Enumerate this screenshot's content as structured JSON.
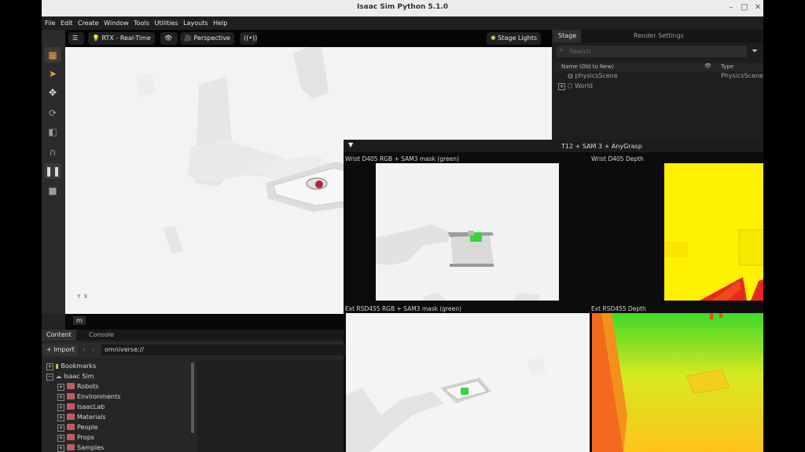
{
  "window": {
    "title": "Isaac Sim Python 5.1.0"
  },
  "menu": [
    "File",
    "Edit",
    "Create",
    "Window",
    "Tools",
    "Utilities",
    "Layouts",
    "Help"
  ],
  "viewport": {
    "renderer_label": "RTX - Real-Time",
    "camera_label": "Perspective",
    "lights_label": "Stage Lights",
    "axis_y": "Y",
    "axis_x": "X",
    "units_label": "m"
  },
  "stage": {
    "tabs": [
      "Stage",
      "Render Settings"
    ],
    "search_placeholder": "Search",
    "col_name": "Name (Old to New)",
    "col_type": "Type",
    "rows": [
      {
        "name": "physicsScene",
        "type": "PhysicsScene"
      },
      {
        "name": "World",
        "type": ""
      }
    ]
  },
  "panel": {
    "title": "T12 + SAM 3 + AnyGrasp",
    "captions": [
      "Wrist D405 RGB + SAM3 mask (green)",
      "Wrist D405 Depth",
      "Ext RSD455 RGB + SAM3 mask (green)",
      "Ext RSD455 Depth"
    ]
  },
  "content": {
    "tabs": [
      "Content",
      "Console"
    ],
    "import_label": "Import",
    "path": "omniverse://",
    "tree": [
      {
        "label": "Bookmarks",
        "level": 0
      },
      {
        "label": "Isaac Sim",
        "level": 0
      },
      {
        "label": "Robots",
        "level": 1
      },
      {
        "label": "Environments",
        "level": 1
      },
      {
        "label": "IsaacLab",
        "level": 1
      },
      {
        "label": "Materials",
        "level": 1
      },
      {
        "label": "People",
        "level": 1
      },
      {
        "label": "Props",
        "level": 1
      },
      {
        "label": "Samples",
        "level": 1
      }
    ]
  },
  "colors": {
    "accent": "#f2a33a",
    "mask": "#3ad33a",
    "depth_far": "#fff200",
    "depth_near": "#e8281e"
  }
}
